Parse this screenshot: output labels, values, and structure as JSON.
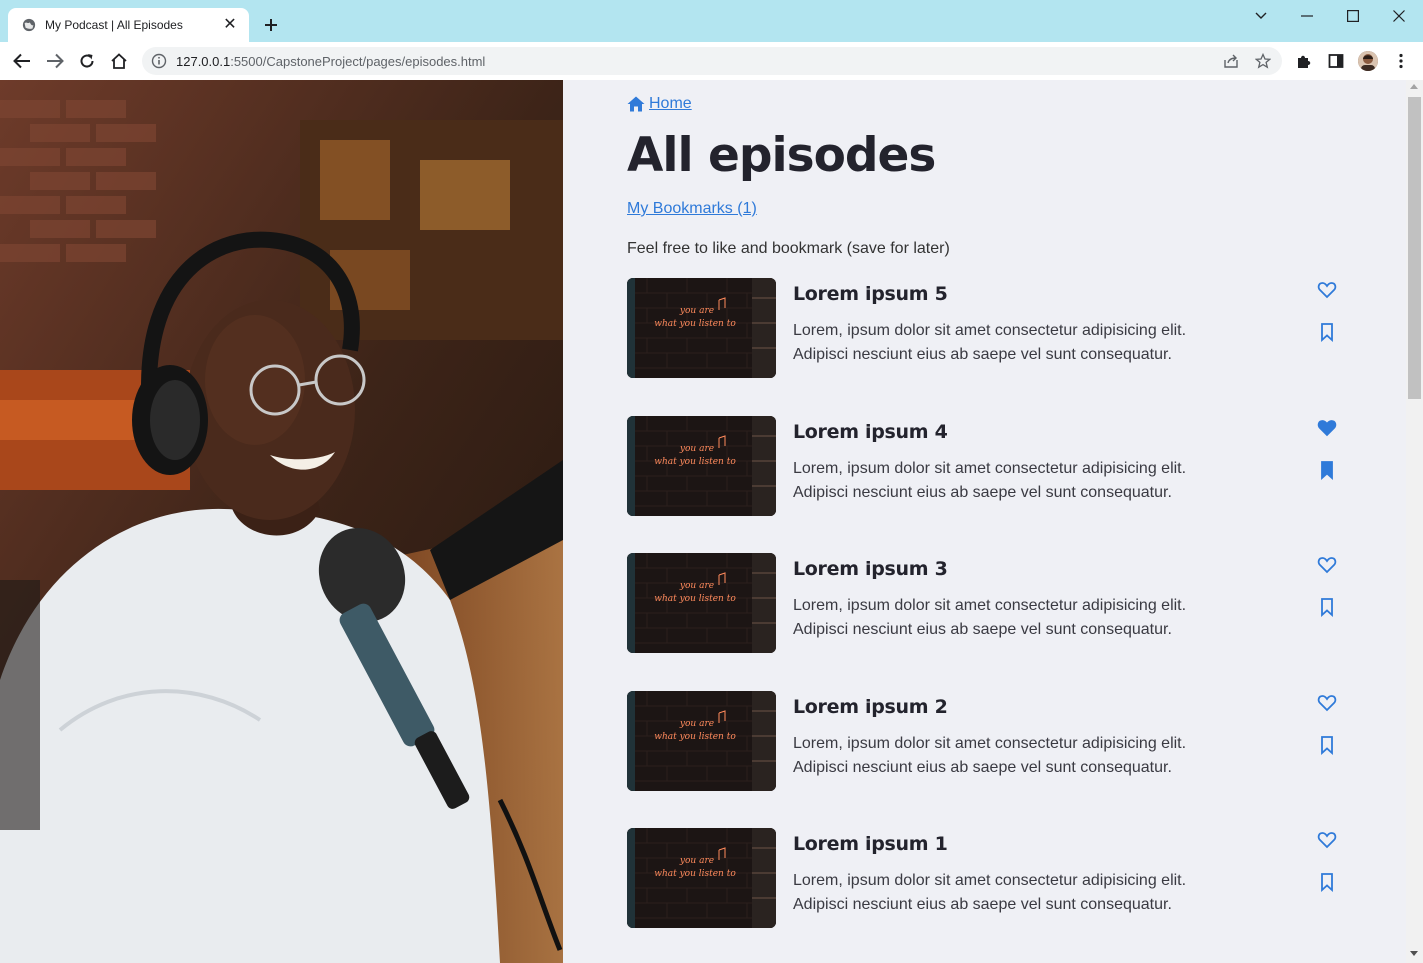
{
  "browser": {
    "tab_title": "My Podcast | All Episodes",
    "url_host": "127.0.0.1",
    "url_path": ":5500/CapstoneProject/pages/episodes.html",
    "icons": [
      "globe-icon",
      "close-icon",
      "plus-icon",
      "chevron-down-icon",
      "minimize-icon",
      "maximize-icon",
      "window-close-icon",
      "back-arrow-icon",
      "forward-arrow-icon",
      "reload-icon",
      "home-icon",
      "info-icon",
      "share-icon",
      "star-icon",
      "extensions-icon",
      "side-panel-icon",
      "kebab-menu-icon"
    ]
  },
  "page": {
    "home_label": "Home",
    "title": "All episodes",
    "bookmarks_link": "My Bookmarks (1)",
    "intro": "Feel free to like and bookmark (save for later)",
    "accent_color": "#2f7ad9",
    "background_color": "#eff0f5",
    "thumbnail_sign_text": "you are what you listen to",
    "episodes": [
      {
        "title": "Lorem ipsum 5",
        "line1": "Lorem, ipsum dolor sit amet consectetur adipisicing elit.",
        "line2": "Adipisci nesciunt eius ab saepe vel sunt consequatur.",
        "liked": false,
        "bookmarked": false
      },
      {
        "title": "Lorem ipsum 4",
        "line1": "Lorem, ipsum dolor sit amet consectetur adipisicing elit.",
        "line2": "Adipisci nesciunt eius ab saepe vel sunt consequatur.",
        "liked": true,
        "bookmarked": true
      },
      {
        "title": "Lorem ipsum 3",
        "line1": "Lorem, ipsum dolor sit amet consectetur adipisicing elit.",
        "line2": "Adipisci nesciunt eius ab saepe vel sunt consequatur.",
        "liked": false,
        "bookmarked": false
      },
      {
        "title": "Lorem ipsum 2",
        "line1": "Lorem, ipsum dolor sit amet consectetur adipisicing elit.",
        "line2": "Adipisci nesciunt eius ab saepe vel sunt consequatur.",
        "liked": false,
        "bookmarked": false
      },
      {
        "title": "Lorem ipsum 1",
        "line1": "Lorem, ipsum dolor sit amet consectetur adipisicing elit.",
        "line2": "Adipisci nesciunt eius ab saepe vel sunt consequatur.",
        "liked": false,
        "bookmarked": false
      }
    ]
  }
}
